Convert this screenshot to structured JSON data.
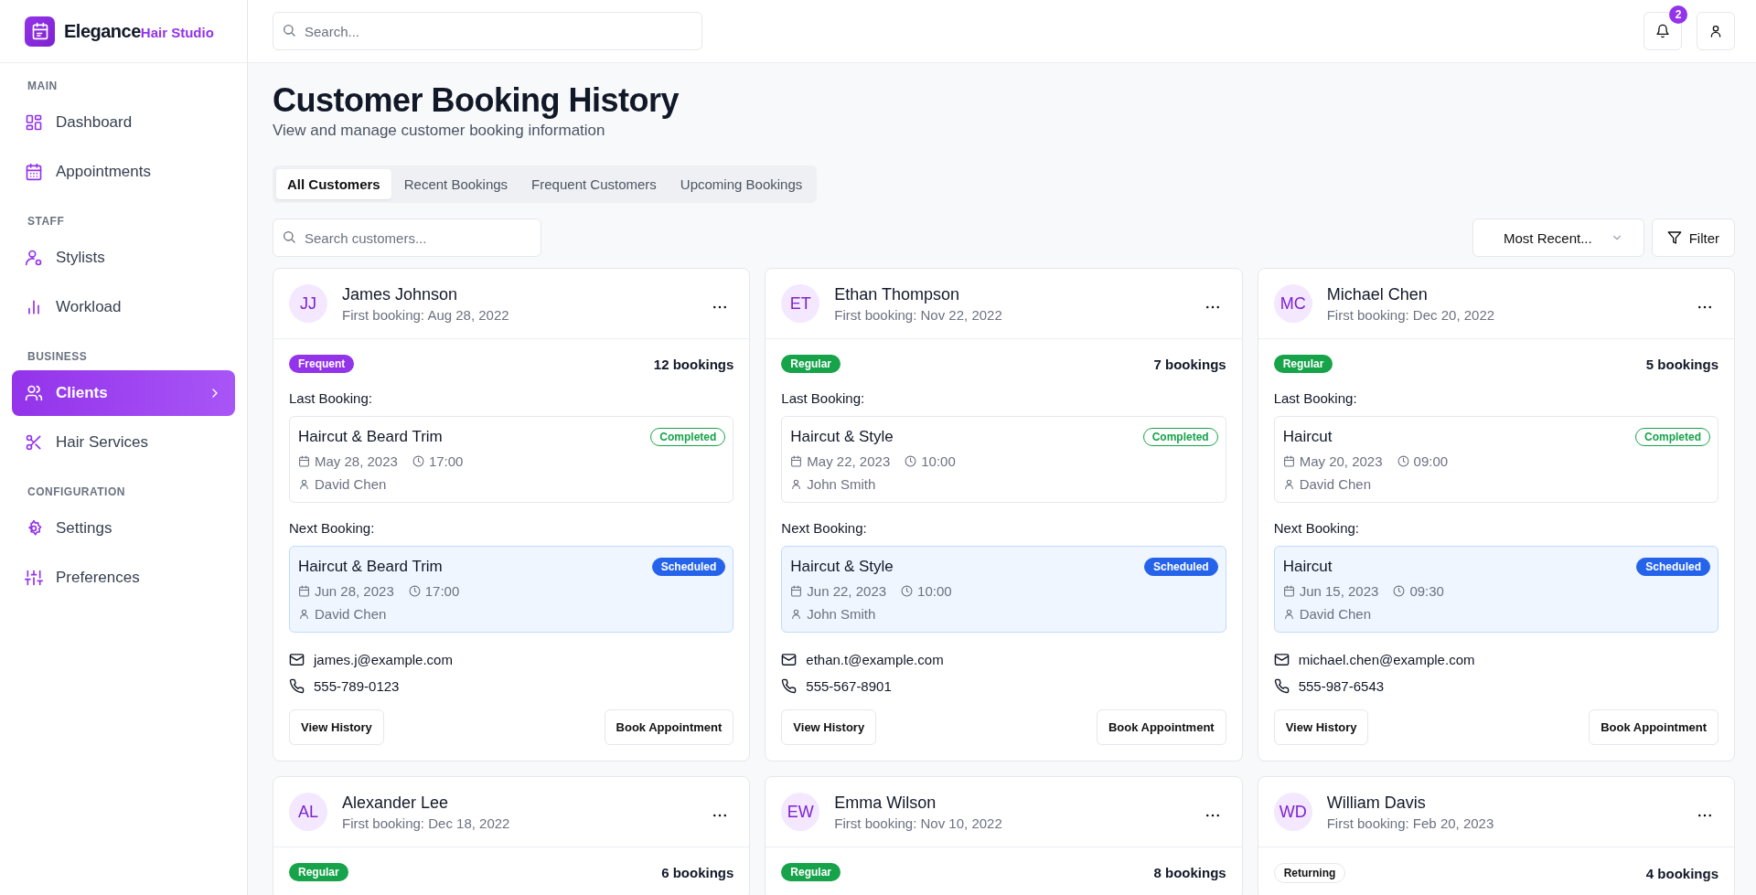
{
  "brand": {
    "name": "Elegance",
    "sub": "Hair Studio"
  },
  "sidebar": {
    "sections": [
      {
        "title": "MAIN",
        "items": [
          {
            "label": "Dashboard",
            "selected": false
          },
          {
            "label": "Appointments",
            "selected": false
          }
        ]
      },
      {
        "title": "STAFF",
        "items": [
          {
            "label": "Stylists",
            "selected": false
          },
          {
            "label": "Workload",
            "selected": false
          }
        ]
      },
      {
        "title": "BUSINESS",
        "items": [
          {
            "label": "Clients",
            "selected": true
          },
          {
            "label": "Hair Services",
            "selected": false
          }
        ]
      },
      {
        "title": "CONFIGURATION",
        "items": [
          {
            "label": "Settings",
            "selected": false
          },
          {
            "label": "Preferences",
            "selected": false
          }
        ]
      }
    ]
  },
  "header": {
    "search_placeholder": "Search...",
    "notification_count": "2"
  },
  "page": {
    "title": "Customer Booking History",
    "subtitle": "View and manage customer booking information"
  },
  "tabs": [
    {
      "label": "All Customers",
      "selected": true
    },
    {
      "label": "Recent Bookings",
      "selected": false
    },
    {
      "label": "Frequent Customers",
      "selected": false
    },
    {
      "label": "Upcoming Bookings",
      "selected": false
    }
  ],
  "toolbar": {
    "search_placeholder": "Search customers...",
    "sort": "Most Recent...",
    "filter": "Filter"
  },
  "customers": [
    {
      "initials": "JJ",
      "name": "James Johnson",
      "first_booking": "First booking: Aug 28, 2022",
      "tag": {
        "label": "Frequent",
        "kind": "frequent"
      },
      "count": "12 bookings",
      "bookings": [
        {
          "heading": "Last Booking:",
          "kind": "last",
          "service": "Haircut & Beard Trim",
          "status": {
            "label": "Completed",
            "kind": "completed"
          },
          "date": "May 28, 2023",
          "time": "17:00",
          "stylist": "David Chen"
        },
        {
          "heading": "Next Booking:",
          "kind": "next",
          "service": "Haircut & Beard Trim",
          "status": {
            "label": "Scheduled",
            "kind": "scheduled"
          },
          "date": "Jun 28, 2023",
          "time": "17:00",
          "stylist": "David Chen"
        }
      ],
      "email": "james.j@example.com",
      "phone": "555-789-0123",
      "actions": [
        "View History",
        "Book Appointment"
      ]
    },
    {
      "initials": "ET",
      "name": "Ethan Thompson",
      "first_booking": "First booking: Nov 22, 2022",
      "tag": {
        "label": "Regular",
        "kind": "regular"
      },
      "count": "7 bookings",
      "bookings": [
        {
          "heading": "Last Booking:",
          "kind": "last",
          "service": "Haircut & Style",
          "status": {
            "label": "Completed",
            "kind": "completed"
          },
          "date": "May 22, 2023",
          "time": "10:00",
          "stylist": "John Smith"
        },
        {
          "heading": "Next Booking:",
          "kind": "next",
          "service": "Haircut & Style",
          "status": {
            "label": "Scheduled",
            "kind": "scheduled"
          },
          "date": "Jun 22, 2023",
          "time": "10:00",
          "stylist": "John Smith"
        }
      ],
      "email": "ethan.t@example.com",
      "phone": "555-567-8901",
      "actions": [
        "View History",
        "Book Appointment"
      ]
    },
    {
      "initials": "MC",
      "name": "Michael Chen",
      "first_booking": "First booking: Dec 20, 2022",
      "tag": {
        "label": "Regular",
        "kind": "regular"
      },
      "count": "5 bookings",
      "bookings": [
        {
          "heading": "Last Booking:",
          "kind": "last",
          "service": "Haircut",
          "status": {
            "label": "Completed",
            "kind": "completed"
          },
          "date": "May 20, 2023",
          "time": "09:00",
          "stylist": "David Chen"
        },
        {
          "heading": "Next Booking:",
          "kind": "next",
          "service": "Haircut",
          "status": {
            "label": "Scheduled",
            "kind": "scheduled"
          },
          "date": "Jun 15, 2023",
          "time": "09:30",
          "stylist": "David Chen"
        }
      ],
      "email": "michael.chen@example.com",
      "phone": "555-987-6543",
      "actions": [
        "View History",
        "Book Appointment"
      ]
    },
    {
      "initials": "AL",
      "name": "Alexander Lee",
      "first_booking": "First booking: Dec 18, 2022",
      "tag": {
        "label": "Regular",
        "kind": "regular"
      },
      "count": "6 bookings"
    },
    {
      "initials": "EW",
      "name": "Emma Wilson",
      "first_booking": "First booking: Nov 10, 2022",
      "tag": {
        "label": "Regular",
        "kind": "regular"
      },
      "count": "8 bookings"
    },
    {
      "initials": "WD",
      "name": "William Davis",
      "first_booking": "First booking: Feb 20, 2023",
      "tag": {
        "label": "Returning",
        "kind": "returning"
      },
      "count": "4 bookings"
    }
  ]
}
